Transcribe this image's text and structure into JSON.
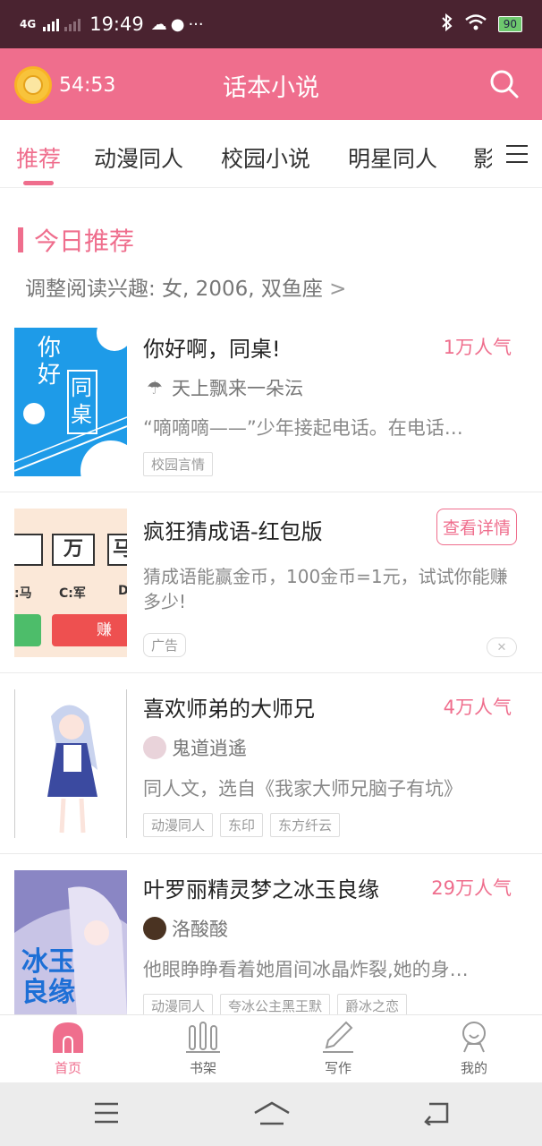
{
  "status_bar": {
    "network": "4G",
    "time": "19:49",
    "battery": "90"
  },
  "header": {
    "timer": "54:53",
    "title": "话本小说"
  },
  "tabs": [
    "推荐",
    "动漫同人",
    "校园小说",
    "明星同人",
    "影视"
  ],
  "section": {
    "title": "今日推荐",
    "interest": "调整阅读兴趣: 女, 2006, 双鱼座 ",
    "interest_arrow": ">"
  },
  "books": [
    {
      "title": "你好啊，同桌!",
      "popularity": "1万人气",
      "author": "天上飘来一朵沄",
      "desc": "“嘀嘀嘀——”少年接起电话。在电话…",
      "tags": [
        "校园言情"
      ],
      "cover_text": [
        "你好",
        "同桌"
      ]
    },
    {
      "title": "喜欢师弟的大师兄",
      "popularity": "4万人气",
      "author": "鬼道逍遙",
      "desc": "同人文，选自《我家大师兄脑子有坑》",
      "tags": [
        "动漫同人",
        "东印",
        "东方纤云"
      ]
    },
    {
      "title": "叶罗丽精灵梦之冰玉良缘",
      "popularity": "29万人气",
      "author": "洛酸酸",
      "desc": "他眼睁睁看着她眉间冰晶炸裂,她的身…",
      "tags": [
        "动漫同人",
        "夸冰公主黑王默",
        "爵冰之恋"
      ],
      "cover_text": "冰玉良缘"
    }
  ],
  "ad": {
    "title": "疯狂猜成语-红包版",
    "button": "查看详情",
    "desc": "猜成语能赢金币，100金币=1元，试试你能赚多少!",
    "label": "广告",
    "close": "✕",
    "cover": {
      "chars": [
        "万",
        "马"
      ],
      "options": [
        ":马",
        "C:军",
        "D"
      ],
      "btn": "赚"
    }
  },
  "bottom_nav": [
    {
      "label": "首页",
      "icon": "home-icon"
    },
    {
      "label": "书架",
      "icon": "bookshelf-icon"
    },
    {
      "label": "写作",
      "icon": "pen-icon"
    },
    {
      "label": "我的",
      "icon": "profile-icon"
    }
  ],
  "colors": {
    "accent": "#ef6e8d",
    "status_bar": "#4a2330"
  }
}
